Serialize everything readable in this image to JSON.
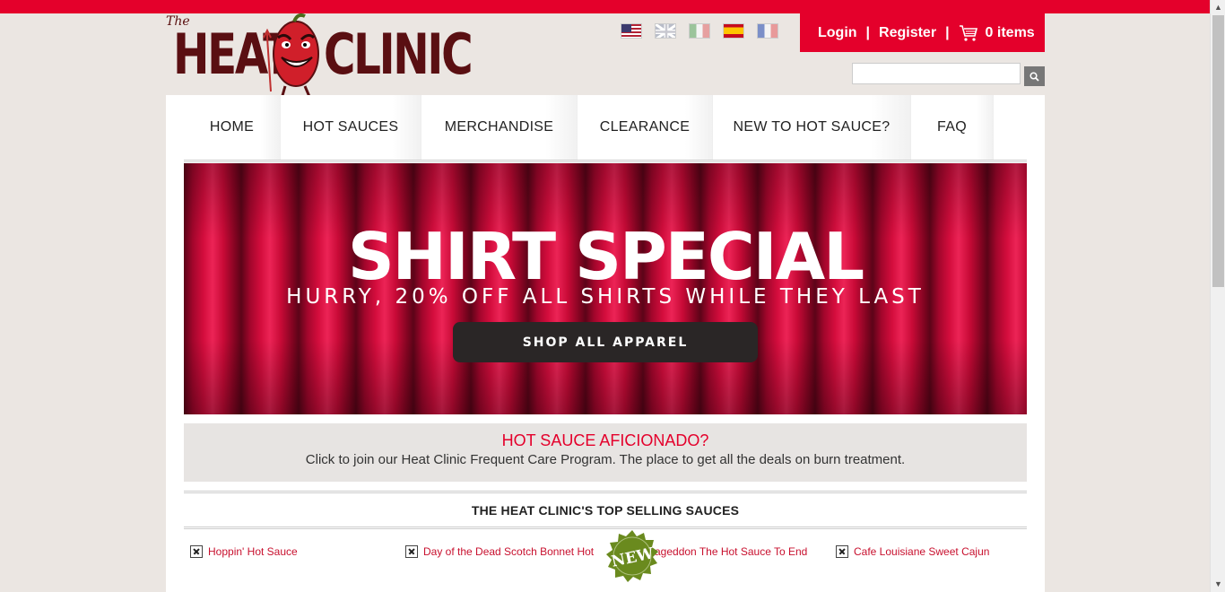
{
  "header": {
    "logo": {
      "the": "The",
      "word1": "HEAT",
      "word2": "CLINIC"
    },
    "languages": [
      {
        "name": "us-flag-icon",
        "label": "English (US)"
      },
      {
        "name": "uk-flag-icon",
        "label": "English (UK)"
      },
      {
        "name": "mexico-flag-icon",
        "label": "Español (MX)"
      },
      {
        "name": "spain-flag-icon",
        "label": "Español (ES)"
      },
      {
        "name": "france-flag-icon",
        "label": "Français"
      }
    ],
    "account": {
      "login": "Login",
      "separator": "|",
      "register": "Register",
      "cart": "0 items"
    },
    "search": {
      "value": "",
      "placeholder": ""
    }
  },
  "nav": {
    "items": [
      "HOME",
      "HOT SAUCES",
      "MERCHANDISE",
      "CLEARANCE",
      "NEW TO HOT SAUCE?",
      "FAQ"
    ]
  },
  "banner": {
    "title": "SHIRT SPECIAL",
    "subtitle": "HURRY, 20% OFF ALL SHIRTS WHILE THEY LAST",
    "button": "SHOP ALL APPAREL"
  },
  "promo": {
    "title": "HOT SAUCE AFICIONADO?",
    "text": "Click to join our Heat Clinic Frequent Care Program. The place to get all the deals on burn treatment."
  },
  "top_selling": {
    "title": "THE HEAT CLINIC'S TOP SELLING SAUCES",
    "badge": "NEW",
    "products": [
      "Hoppin' Hot Sauce",
      "Day of the Dead Scotch Bonnet Hot",
      "ageddon The Hot Sauce To End",
      "Cafe Louisiane Sweet Cajun"
    ]
  },
  "colors": {
    "accent": "#e4002b",
    "logo": "#5a0f12",
    "badge": "#6a8a1e"
  }
}
